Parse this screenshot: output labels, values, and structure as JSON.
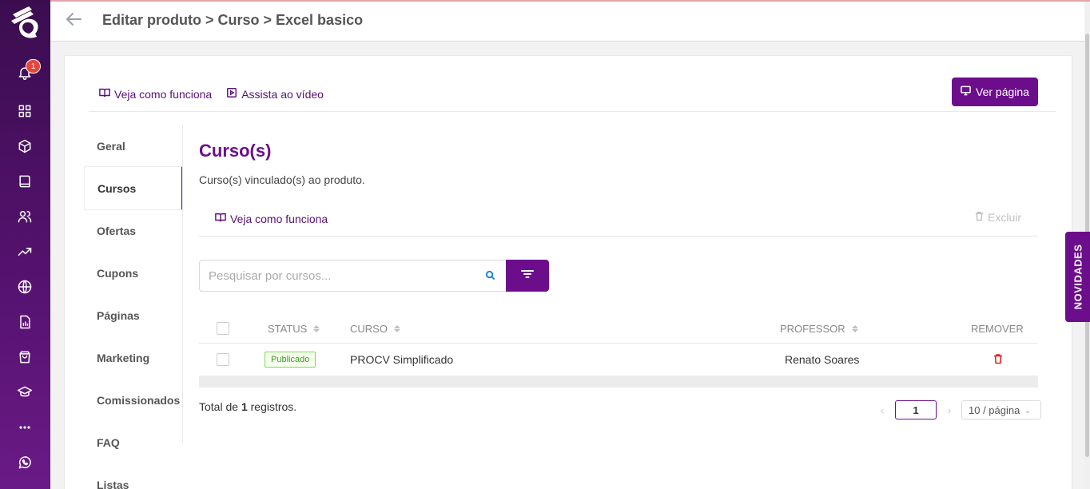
{
  "sidebar": {
    "notification_count": "1",
    "icons": [
      "bell-icon",
      "grid-icon",
      "cube-icon",
      "book-icon",
      "users-icon",
      "trend-icon",
      "globe-icon",
      "report-icon",
      "bag-icon",
      "graduation-icon",
      "more-icon",
      "whatsapp-icon"
    ]
  },
  "header": {
    "breadcrumb": "Editar produto > Curso > Excel basico"
  },
  "top_links": {
    "how_it_works": "Veja como funciona",
    "watch_video": "Assista ao vídeo",
    "view_page": "Ver página"
  },
  "menu": {
    "items": [
      "Geral",
      "Cursos",
      "Ofertas",
      "Cupons",
      "Páginas",
      "Marketing",
      "Comissionados",
      "FAQ",
      "Listas"
    ],
    "active": "Cursos"
  },
  "content": {
    "title": "Curso(s)",
    "description": "Curso(s) vinculado(s) ao produto.",
    "how_it_works": "Veja como funciona",
    "delete_label": "Excluir"
  },
  "search": {
    "placeholder": "Pesquisar por cursos..."
  },
  "table": {
    "headers": {
      "status": "STATUS",
      "course": "CURSO",
      "teacher": "PROFESSOR",
      "remove": "REMOVER"
    },
    "rows": [
      {
        "status": "Publicado",
        "course": "PROCV Simplificado",
        "teacher": "Renato Soares"
      }
    ]
  },
  "footer": {
    "total_prefix": "Total de ",
    "total_count": "1",
    "total_suffix": " registros.",
    "current_page": "1",
    "page_size": "10 / página"
  },
  "news_tab": "NOVIDADES",
  "colors": {
    "accent": "#6c0e8c",
    "sidebar": "#4a1062",
    "published": "#52c41a",
    "danger": "#e02424"
  }
}
